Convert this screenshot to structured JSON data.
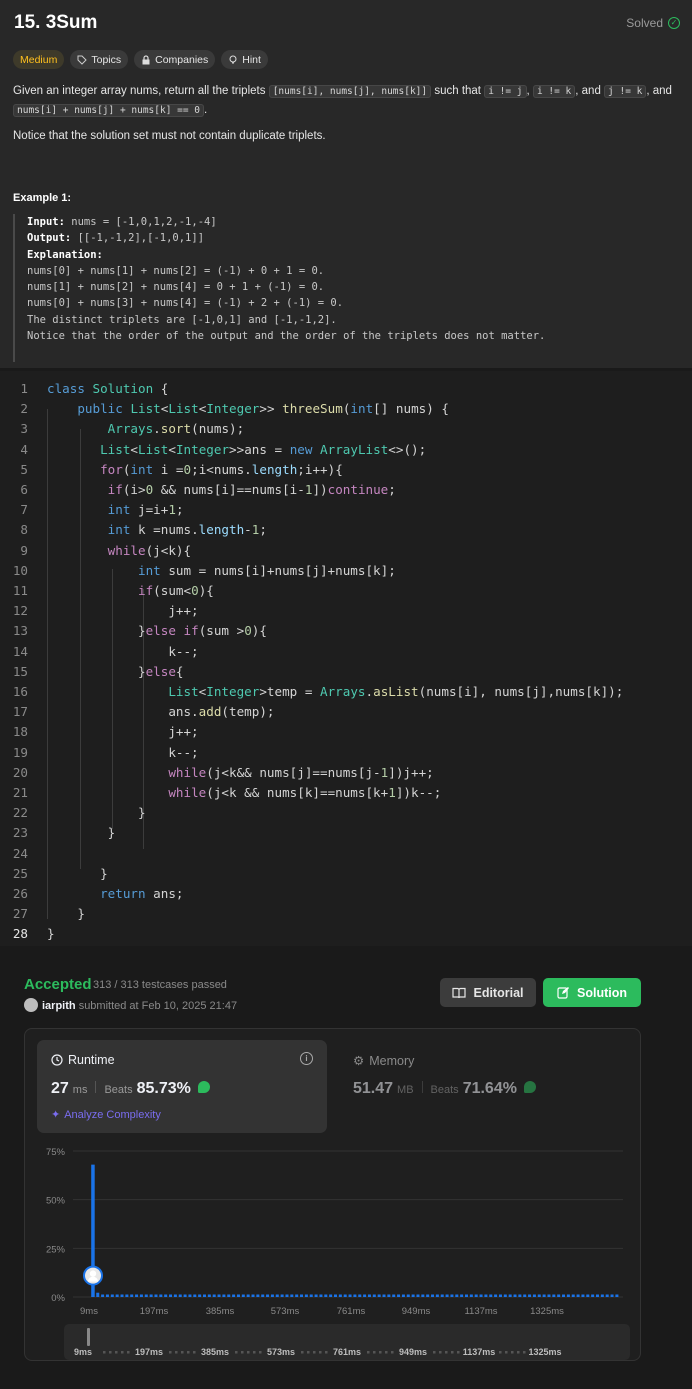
{
  "problem": {
    "title": "15. 3Sum",
    "status": "Solved",
    "tags": [
      "Medium",
      "Topics",
      "Companies",
      "Hint"
    ],
    "desc": {
      "p1": "Given an integer array nums, return all the triplets",
      "c1": "[nums[i], nums[j], nums[k]]",
      "p2": "such that",
      "c2": "i != j",
      "p3": ",",
      "c3": "i != k",
      "p4": ", and",
      "c4": "j != k",
      "p5": ", and",
      "c5": "nums[i] + nums[j] + nums[k] == 0",
      "p6": "."
    },
    "notice": "Notice that the solution set must not contain duplicate triplets.",
    "example_title": "Example 1:",
    "example": {
      "input_label": "Input:",
      "input_value": "nums = [-1,0,1,2,-1,-4]",
      "output_label": "Output:",
      "output_value": "[[-1,-1,2],[-1,0,1]]",
      "explanation_label": "Explanation:",
      "lines": [
        "nums[0] + nums[1] + nums[2] = (-1) + 0 + 1 = 0.",
        "nums[1] + nums[2] + nums[4] = 0 + 1 + (-1) = 0.",
        "nums[0] + nums[3] + nums[4] = (-1) + 2 + (-1) = 0.",
        "The distinct triplets are [-1,0,1] and [-1,-1,2].",
        "Notice that the order of the output and the order of the triplets does not matter."
      ]
    }
  },
  "editor": {
    "current_line": 28,
    "lines": [
      "class Solution {",
      "    public List<List<Integer>> threeSum(int[] nums) {",
      "        Arrays.sort(nums);",
      "       List<List<Integer>>ans = new ArrayList<>();",
      "       for(int i =0;i<nums.length;i++){",
      "        if(i>0 && nums[i]==nums[i-1])continue;",
      "        int j=i+1;",
      "        int k =nums.length-1;",
      "        while(j<k){",
      "            int sum = nums[i]+nums[j]+nums[k];",
      "            if(sum<0){",
      "                j++;",
      "            }else if(sum >0){",
      "                k--;",
      "            }else{",
      "                List<Integer>temp = Arrays.asList(nums[i], nums[j],nums[k]);",
      "                ans.add(temp);",
      "                j++;",
      "                k--;",
      "                while(j<k&& nums[j]==nums[j-1])j++;",
      "                while(j<k && nums[k]==nums[k+1])k--;",
      "            }",
      "        }",
      "",
      "       }",
      "       return ans;",
      "    }",
      "}"
    ]
  },
  "result": {
    "status": "Accepted",
    "testcases": "313 / 313 testcases passed",
    "user": "iarpith",
    "submitted_text": "submitted at Feb 10, 2025 21:47",
    "editorial_label": "Editorial",
    "solution_label": "Solution",
    "runtime": {
      "label": "Runtime",
      "value": "27",
      "unit": "ms",
      "beats_label": "Beats",
      "beats": "85.73%",
      "analyze": "Analyze Complexity"
    },
    "memory": {
      "label": "Memory",
      "value": "51.47",
      "unit": "MB",
      "beats_label": "Beats",
      "beats": "71.64%"
    },
    "colors": {
      "accent_green": "#2cbb5d",
      "bar_blue": "#1a73e8",
      "medium_yellow": "#ffc01e"
    }
  },
  "chart_data": {
    "type": "bar",
    "ylabel_ticks": [
      "75%",
      "50%",
      "25%",
      "0%"
    ],
    "ylim": [
      0,
      75
    ],
    "x_ticks": [
      "9ms",
      "197ms",
      "385ms",
      "573ms",
      "761ms",
      "949ms",
      "1137ms",
      "1325ms"
    ],
    "xlim": [
      9,
      1500
    ],
    "values": [
      68,
      2.2,
      1,
      1,
      1,
      1,
      1,
      1,
      1,
      1,
      1,
      1,
      1,
      1,
      1,
      1,
      1,
      1,
      1,
      1,
      1,
      1,
      1,
      1,
      1,
      1,
      1,
      1,
      1,
      1,
      1,
      1,
      1,
      1,
      1,
      1,
      1,
      1,
      1,
      1,
      1,
      1,
      1,
      1,
      1,
      1,
      1,
      1,
      1,
      1,
      1,
      1,
      1,
      1,
      1,
      1,
      1,
      1,
      1,
      1,
      1,
      1,
      1,
      1,
      1,
      1,
      1,
      1,
      1,
      1,
      1,
      1,
      1,
      1,
      1,
      1,
      1,
      1,
      1,
      1,
      1,
      1,
      1,
      1,
      1,
      1,
      1,
      1,
      1,
      1,
      1,
      1,
      1,
      1,
      1,
      1,
      1,
      1,
      1,
      1,
      1,
      1,
      1,
      1,
      1,
      1,
      1,
      1,
      1
    ],
    "marker_index": 0,
    "marker_value": 11,
    "grid": true,
    "navigator_ticks": [
      "9ms",
      "197ms",
      "385ms",
      "573ms",
      "761ms",
      "949ms",
      "1137ms",
      "1325ms"
    ]
  }
}
